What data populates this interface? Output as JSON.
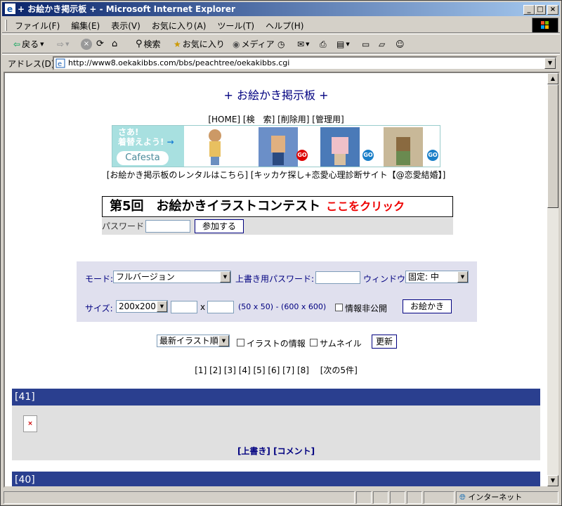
{
  "window": {
    "title": "+ お絵かき掲示板 + - Microsoft Internet Explorer",
    "min": "_",
    "max": "□",
    "close": "×"
  },
  "menu": [
    "ファイル(F)",
    "編集(E)",
    "表示(V)",
    "お気に入り(A)",
    "ツール(T)",
    "ヘルプ(H)"
  ],
  "toolbar": {
    "back": "戻る",
    "search": "検索",
    "favorites": "お気に入り",
    "media": "メディア"
  },
  "address": {
    "label": "アドレス(D)",
    "url": "http://www8.oekakibbs.com/bbs/peachtree/oekakibbs.cgi"
  },
  "page": {
    "title": "+ お絵かき掲示板 +",
    "top_links": "[HOME] [検　索] [削除用] [管理用]",
    "banner": {
      "line1": "さあ!",
      "line2": "着替えよう!",
      "logo": "Cafesta",
      "go": "GO"
    },
    "rental_links": "[お絵かき掲示板のレンタルはこちら] [キッカケ探し+恋愛心理診断サイト【@恋愛結婚】]",
    "contest": {
      "text": "第5回　お絵かきイラストコンテスト",
      "click": "ここをクリック"
    },
    "password_label": "パスワード",
    "join_button": "参加する",
    "form": {
      "mode_label": "モード:",
      "mode_value": "フルバージョン",
      "overwrite_label": "上書き用パスワード:",
      "window_label": "ウィンドウ:",
      "window_value": "固定: 中",
      "size_label": "サイズ:",
      "size_value": "200x200",
      "x": "x",
      "range": "(50 x 50) - (600 x 600)",
      "private_label": "情報非公開",
      "draw_button": "お絵かき"
    },
    "sort_value": "最新イラスト順",
    "info_label": "イラストの情報",
    "thumb_label": "サムネイル",
    "refresh_button": "更新",
    "pagination": "[1] [2] [3] [4] [5] [6] [7] [8]　 [次の5件]",
    "posts": [
      {
        "header": "[41]",
        "links": "[上書き] [コメント]"
      },
      {
        "header": "[40]"
      }
    ]
  },
  "status": {
    "zone": "インターネット"
  }
}
